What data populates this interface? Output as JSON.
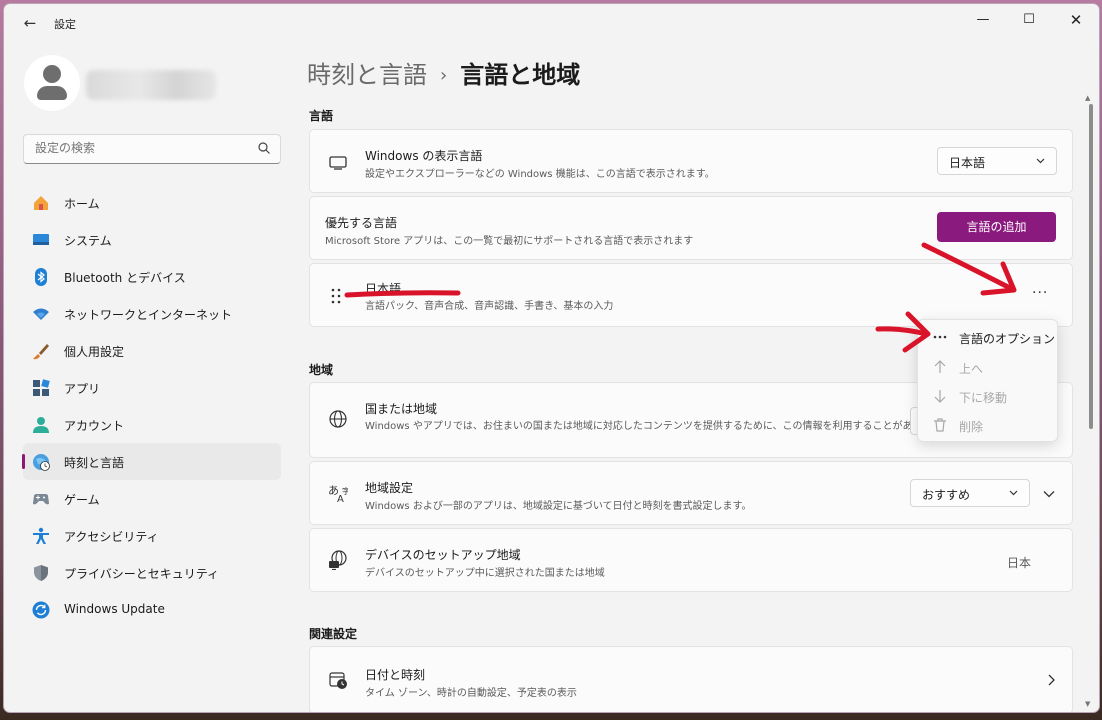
{
  "window": {
    "title": "設定",
    "controls": {
      "minimize": "—",
      "maximize": "☐",
      "close": "✕"
    }
  },
  "search": {
    "placeholder": "設定の検索"
  },
  "sidebar": {
    "items": [
      {
        "label": "ホーム",
        "icon": "home-icon"
      },
      {
        "label": "システム",
        "icon": "system-icon"
      },
      {
        "label": "Bluetooth とデバイス",
        "icon": "bluetooth-icon"
      },
      {
        "label": "ネットワークとインターネット",
        "icon": "wifi-icon"
      },
      {
        "label": "個人用設定",
        "icon": "brush-icon"
      },
      {
        "label": "アプリ",
        "icon": "apps-icon"
      },
      {
        "label": "アカウント",
        "icon": "account-icon"
      },
      {
        "label": "時刻と言語",
        "icon": "time-language-icon",
        "active": true
      },
      {
        "label": "ゲーム",
        "icon": "gaming-icon"
      },
      {
        "label": "アクセシビリティ",
        "icon": "accessibility-icon"
      },
      {
        "label": "プライバシーとセキュリティ",
        "icon": "shield-icon"
      },
      {
        "label": "Windows Update",
        "icon": "update-icon"
      }
    ]
  },
  "breadcrumb": {
    "parent": "時刻と言語",
    "separator": "›",
    "current": "言語と地域"
  },
  "language_section": {
    "title": "言語",
    "display_language": {
      "title": "Windows の表示言語",
      "desc": "設定やエクスプローラーなどの Windows 機能は、この言語で表示されます。",
      "value": "日本語"
    },
    "preferred": {
      "title": "優先する言語",
      "desc": "Microsoft Store アプリは、この一覧で最初にサポートされる言語で表示されます",
      "add_button": "言語の追加"
    },
    "japanese": {
      "title": "日本語",
      "desc": "言語パック、音声合成、音声認識、手書き、基本の入力",
      "more": "···"
    }
  },
  "context_menu": {
    "items": [
      {
        "label": "言語のオプション",
        "icon": "more-icon",
        "enabled": true
      },
      {
        "label": "上へ",
        "icon": "arrow-up-icon",
        "enabled": false
      },
      {
        "label": "下に移動",
        "icon": "arrow-down-icon",
        "enabled": false
      },
      {
        "label": "削除",
        "icon": "trash-icon",
        "enabled": false
      }
    ]
  },
  "region_section": {
    "title": "地域",
    "country": {
      "title": "国または地域",
      "desc": "Windows やアプリでは、お住まいの国または地域に対応したコンテンツを提供するために、この情報を利用することがありま す"
    },
    "regional_format": {
      "title": "地域設定",
      "desc": "Windows および一部のアプリは、地域設定に基づいて日付と時刻を書式設定します。",
      "value": "おすすめ"
    },
    "device_setup": {
      "title": "デバイスのセットアップ地域",
      "desc": "デバイスのセットアップ中に選択された国または地域",
      "value": "日本"
    }
  },
  "related_section": {
    "title": "関連設定",
    "date_time": {
      "title": "日付と時刻",
      "desc": "タイム ゾーン、時計の自動設定、予定表の表示"
    }
  },
  "annotations": {
    "arrow_color": "#d9142a",
    "underline_color": "#d9142a"
  },
  "colors": {
    "accent": "#8b1a7f",
    "window_bg": "#f3f3f3",
    "card_bg": "#fbfbfb"
  }
}
